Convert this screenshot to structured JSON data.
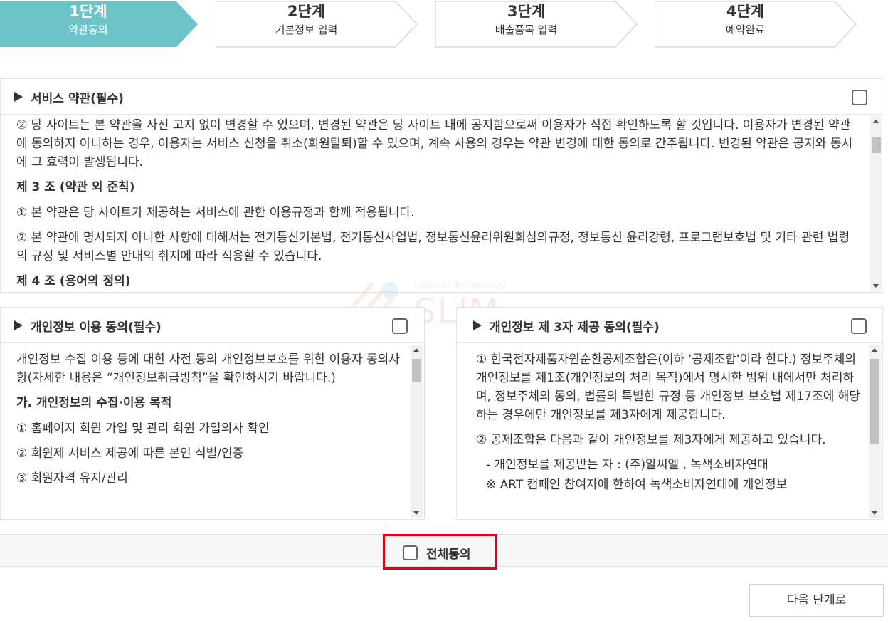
{
  "steps": [
    {
      "num": "1단계",
      "name": "약관동의",
      "active": true
    },
    {
      "num": "2단계",
      "name": "기본정보 입력",
      "active": false
    },
    {
      "num": "3단계",
      "name": "배출품목 입력",
      "active": false
    },
    {
      "num": "4단계",
      "name": "예약완료",
      "active": false
    }
  ],
  "colors": {
    "active_step": "#6cc3c8",
    "highlight": "#e60012"
  },
  "service_terms": {
    "title": "서비스 약관(필수)",
    "paragraphs": [
      {
        "text": "② 당 사이트는 본 약관을 사전 고지 없이 변경할 수 있으며, 변경된 약관은 당 사이트 내에 공지함으로써 이용자가 직접 확인하도록 할 것입니다. 이용자가 변경된 약관에 동의하지 아니하는 경우, 이용자는 서비스 신청을 취소(회원탈퇴)할 수 있으며, 계속 사용의 경우는 약관 변경에 대한 동의로 간주됩니다. 변경된 약관은 공지와 동시에 그 효력이 발생됩니다."
      },
      {
        "text": "제 3 조 (약관 외 준칙)",
        "strong": true
      },
      {
        "text": "① 본 약관은 당 사이트가 제공하는 서비스에 관한 이용규정과 함께 적용됩니다."
      },
      {
        "text": "② 본 약관에 명시되지 아니한 사항에 대해서는 전기통신기본법, 전기통신사업법, 정보통신윤리위원회심의규정, 정보통신 윤리강령, 프로그램보호법 및 기타 관련 법령의 규정 및 서비스별 안내의 취지에 따라 적용할 수 있습니다."
      },
      {
        "text": "제 4 조 (용어의 정의)",
        "strong": true
      }
    ]
  },
  "privacy_use": {
    "title": "개인정보 이용 동의(필수)",
    "paragraphs": [
      {
        "text": "개인정보 수집 이용 등에 대한 사전 동의 개인정보보호를 위한 이용자 동의사항(자세한 내용은 “개인정보취급방침”을 확인하시기 바랍니다.)"
      },
      {
        "text": "가. 개인정보의 수집·이용 목적",
        "strong": true
      },
      {
        "text": "① 홈페이지 회원 가입 및 관리 회원 가입의사 확인"
      },
      {
        "text": "② 회원제 서비스 제공에 따른 본인 식별/인증"
      },
      {
        "text": "③ 회원자격 유지/관리"
      }
    ]
  },
  "third_party": {
    "title": "개인정보 제 3자 제공 동의(필수)",
    "paragraphs": [
      {
        "text": "① 한국전자제품자원순환공제조합은(이하 '공제조합'이라 한다.) 정보주체의 개인정보를 제1조(개인정보의 처리 목적)에서 명시한 범위 내에서만 처리하며, 정보주체의 동의, 법률의 특별한 규정 등 개인정보 보호법 제17조에 해당하는 경우에만 개인정보를 제3자에게 제공합니다."
      },
      {
        "text": "② 공제조합은 다음과 같이 개인정보를 제3자에게 제공하고 있습니다."
      },
      {
        "text": "- 개인정보를 제공받는 자 : (주)알씨엘 , 녹색소비자연대",
        "indent": true,
        "tight": true
      },
      {
        "text": "※ ART 캠페인 참여자에 한하여 녹색소비자연대에 개인정보",
        "indent": true
      }
    ]
  },
  "watermark": {
    "line1": "Internet Technology",
    "line2": "SLIM"
  },
  "agree_all": {
    "label": "전체동의"
  },
  "next_button": {
    "label": "다음 단계로"
  }
}
